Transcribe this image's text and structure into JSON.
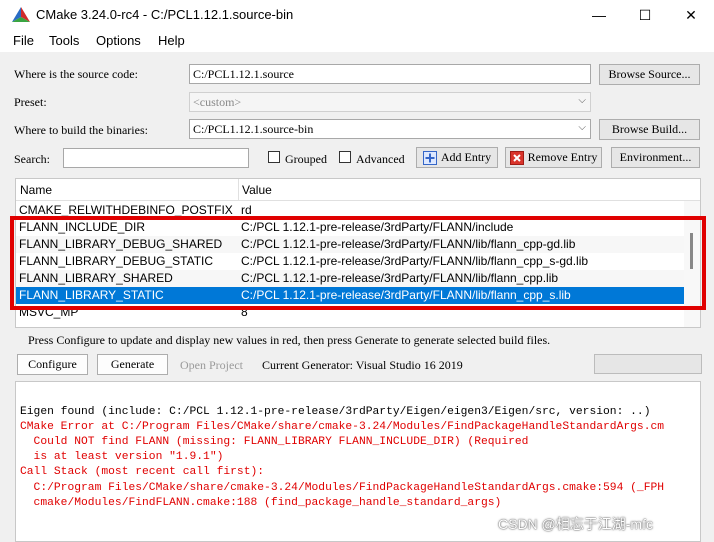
{
  "window": {
    "title": "CMake 3.24.0-rc4 - C:/PCL1.12.1.source-bin",
    "minimize": "—",
    "maximize": "☐",
    "close": "✕"
  },
  "menu": [
    "File",
    "Tools",
    "Options",
    "Help"
  ],
  "form": {
    "source_label": "Where is the source code:",
    "source_value": "C:/PCL1.12.1.source",
    "browse_source": "Browse Source...",
    "preset_label": "Preset:",
    "preset_value": "<custom>",
    "build_label": "Where to build the binaries:",
    "build_value": "C:/PCL1.12.1.source-bin",
    "browse_build": "Browse Build...",
    "search_label": "Search:",
    "search_value": "",
    "grouped": "Grouped",
    "advanced": "Advanced",
    "add_entry": "Add Entry",
    "remove_entry": "Remove Entry",
    "environment": "Environment..."
  },
  "table": {
    "headers": {
      "name": "Name",
      "value": "Value"
    },
    "rows": [
      {
        "name": "CMAKE_RELWITHDEBINFO_POSTFIX",
        "value": "rd"
      },
      {
        "name": "FLANN_INCLUDE_DIR",
        "value": "C:/PCL 1.12.1-pre-release/3rdParty/FLANN/include"
      },
      {
        "name": "FLANN_LIBRARY_DEBUG_SHARED",
        "value": "C:/PCL 1.12.1-pre-release/3rdParty/FLANN/lib/flann_cpp-gd.lib"
      },
      {
        "name": "FLANN_LIBRARY_DEBUG_STATIC",
        "value": "C:/PCL 1.12.1-pre-release/3rdParty/FLANN/lib/flann_cpp_s-gd.lib"
      },
      {
        "name": "FLANN_LIBRARY_SHARED",
        "value": "C:/PCL 1.12.1-pre-release/3rdParty/FLANN/lib/flann_cpp.lib"
      },
      {
        "name": "FLANN_LIBRARY_STATIC",
        "value": "C:/PCL 1.12.1-pre-release/3rdParty/FLANN/lib/flann_cpp_s.lib"
      },
      {
        "name": "MSVC_MP",
        "value": "8"
      }
    ]
  },
  "status_message": "Press Configure to update and display new values in red, then press Generate to generate selected build files.",
  "actions": {
    "configure": "Configure",
    "generate": "Generate",
    "open_project": "Open Project",
    "generator": "Current Generator: Visual Studio 16 2019"
  },
  "log": [
    {
      "text": "Eigen found (include: C:/PCL 1.12.1-pre-release/3rdParty/Eigen/eigen3/Eigen/src, version: ..)",
      "color": "#000000"
    },
    {
      "text": "CMake Error at C:/Program Files/CMake/share/cmake-3.24/Modules/FindPackageHandleStandardArgs.cm",
      "color": "#e00000"
    },
    {
      "text": "  Could NOT find FLANN (missing: FLANN_LIBRARY FLANN_INCLUDE_DIR) (Required",
      "color": "#e00000"
    },
    {
      "text": "  is at least version \"1.9.1\")",
      "color": "#e00000"
    },
    {
      "text": "Call Stack (most recent call first):",
      "color": "#e00000"
    },
    {
      "text": "  C:/Program Files/CMake/share/cmake-3.24/Modules/FindPackageHandleStandardArgs.cmake:594 (_FPH",
      "color": "#e00000"
    },
    {
      "text": "  cmake/Modules/FindFLANN.cmake:188 (find_package_handle_standard_args)",
      "color": "#e00000"
    }
  ],
  "watermark": "CSDN @相忘于江湖-mfc"
}
